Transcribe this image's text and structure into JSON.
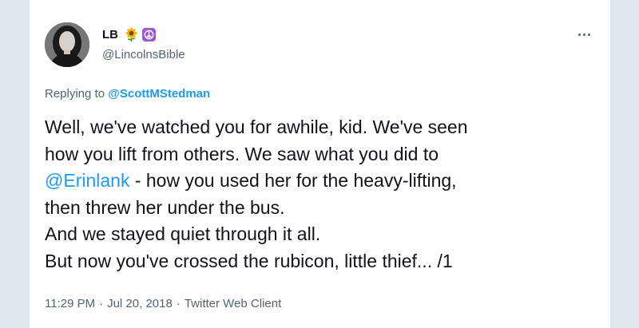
{
  "tweet": {
    "display_name": "LB",
    "badges": [
      "sunflower-icon",
      "peace-symbol-icon"
    ],
    "handle": "@LincolnsBible",
    "reply_prefix": "Replying to",
    "reply_to": "@ScottMStedman",
    "text_lines": [
      {
        "text": "Well, we've watched you for awhile, kid. We've seen"
      },
      {
        "text": "how you lift from others. We saw what you did to"
      },
      {
        "mention": "@Erinlank",
        "text": " - how you used her for the heavy-lifting,"
      },
      {
        "text": "then threw her under the bus."
      },
      {
        "text": "And we stayed quiet through it all."
      },
      {
        "text": "But now you've crossed the rubicon, little thief... /1"
      }
    ],
    "time": "11:29 PM",
    "separator": "·",
    "date": "Jul 20, 2018",
    "source": "Twitter Web Client"
  },
  "colors": {
    "background": "#e1e8ed",
    "card": "#ffffff",
    "text_primary": "#0f1419",
    "text_secondary": "#536471",
    "link": "#1d9bf0",
    "peace_badge": "#9b59d0"
  }
}
